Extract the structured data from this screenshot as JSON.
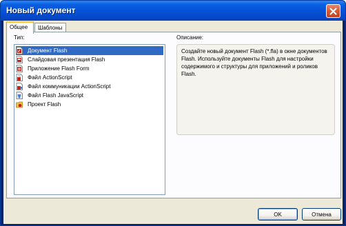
{
  "window": {
    "title": "Новый документ"
  },
  "tabs": [
    {
      "label": "Общее",
      "active": true
    },
    {
      "label": "Шаблоны",
      "active": false
    }
  ],
  "type_list": {
    "label": "Тип:",
    "items": [
      {
        "label": "Документ Flash",
        "icon": "flash-document-icon",
        "selected": true
      },
      {
        "label": "Слайдовая презентация Flash",
        "icon": "flash-slide-presentation-icon",
        "selected": false
      },
      {
        "label": "Приложение Flash Form",
        "icon": "flash-form-application-icon",
        "selected": false
      },
      {
        "label": "Файл ActionScript",
        "icon": "actionscript-file-icon",
        "selected": false
      },
      {
        "label": "Файл коммуникации ActionScript",
        "icon": "actionscript-communication-file-icon",
        "selected": false
      },
      {
        "label": "Файл Flash JavaScript",
        "icon": "flash-javascript-file-icon",
        "selected": false
      },
      {
        "label": "Проект Flash",
        "icon": "flash-project-icon",
        "selected": false
      }
    ]
  },
  "description": {
    "label": "Описание:",
    "text": "Создайте новый документ Flash (*.fla) в окне документов Flash. Используйте документы Flash для настройки содержимого и структуры для приложений и роликов Flash."
  },
  "buttons": {
    "ok": "OK",
    "cancel": "Отмена"
  },
  "colors": {
    "titlebar": "#0553d8",
    "selection": "#316ac5",
    "dialog_bg": "#ece9d8"
  }
}
